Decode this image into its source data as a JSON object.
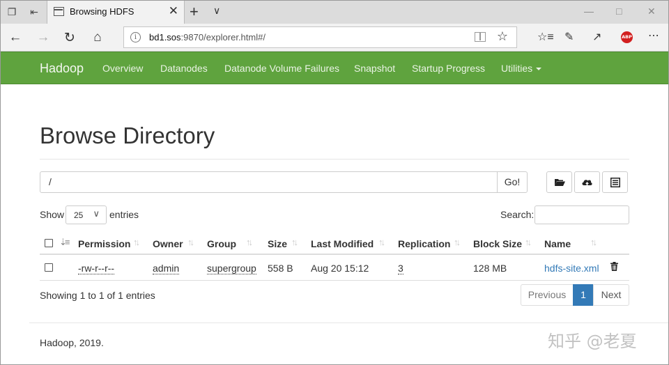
{
  "browser": {
    "tab_title": "Browsing HDFS",
    "url_host": "bd1.sos",
    "url_rest": ":9870/explorer.html#/"
  },
  "navbar": {
    "brand": "Hadoop",
    "items": [
      "Overview",
      "Datanodes",
      "Datanode Volume Failures",
      "Snapshot",
      "Startup Progress",
      "Utilities"
    ]
  },
  "page": {
    "title": "Browse Directory",
    "path_value": "/",
    "go_label": "Go!",
    "show_label": "Show",
    "page_length": "25",
    "entries_label": "entries",
    "search_label": "Search:"
  },
  "table": {
    "headers": [
      "Permission",
      "Owner",
      "Group",
      "Size",
      "Last Modified",
      "Replication",
      "Block Size",
      "Name"
    ],
    "rows": [
      {
        "permission": "-rw-r--r--",
        "owner": "admin",
        "group": "supergroup",
        "size": "558 B",
        "last_modified": "Aug 20 15:12",
        "replication": "3",
        "block_size": "128 MB",
        "name": "hdfs-site.xml"
      }
    ]
  },
  "pagination": {
    "info": "Showing 1 to 1 of 1 entries",
    "previous": "Previous",
    "current": "1",
    "next": "Next"
  },
  "footer": "Hadoop, 2019.",
  "watermark": "知乎 @老夏",
  "colors": {
    "navbar": "#5fa33e",
    "link": "#337ab7",
    "active_page": "#337ab7"
  }
}
